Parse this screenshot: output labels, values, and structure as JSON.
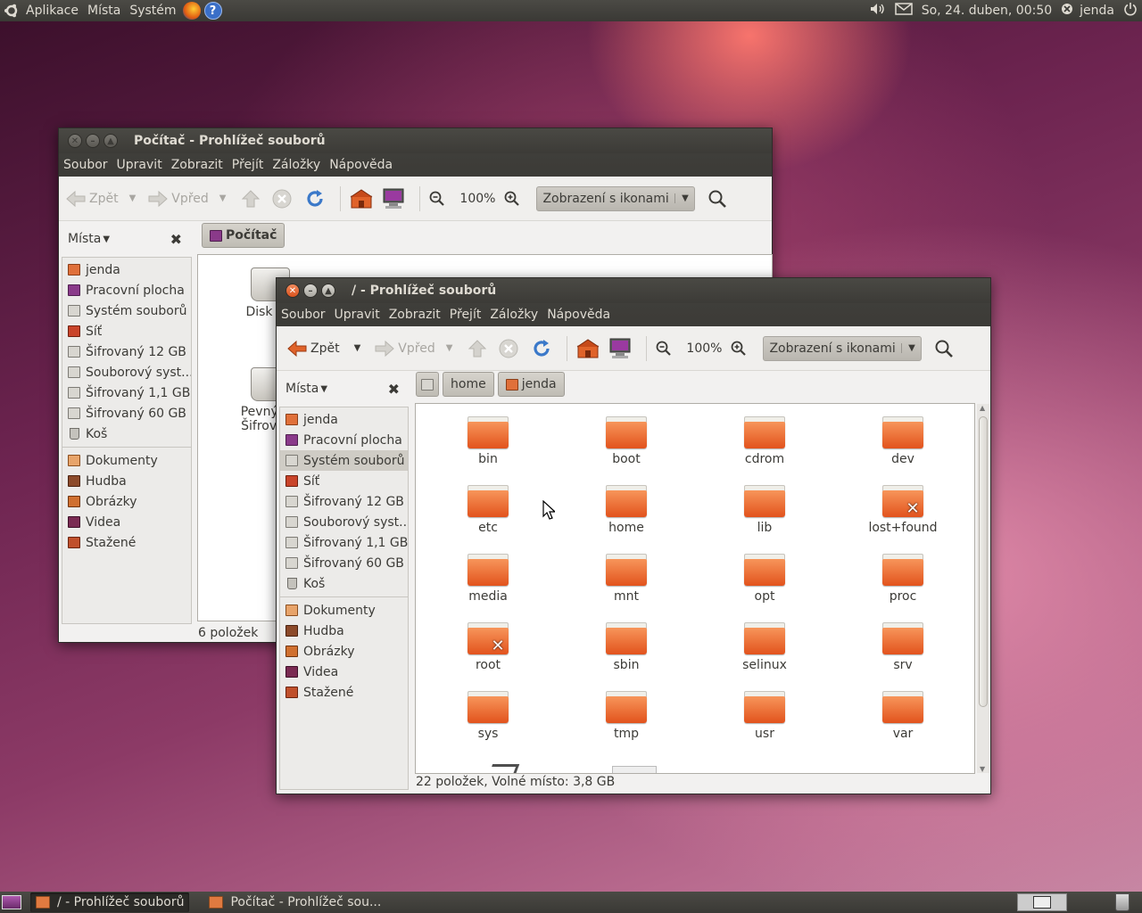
{
  "top_panel": {
    "menus": [
      "Aplikace",
      "Místa",
      "Systém"
    ],
    "datetime": "So, 24. duben, 00:50",
    "user": "jenda",
    "icons": [
      "ubuntu-logo-icon",
      "firefox-icon",
      "help-icon",
      "volume-icon",
      "mail-icon",
      "user-status-icon",
      "power-icon"
    ]
  },
  "bottom_panel": {
    "tasks": [
      "/ - Prohlížeč souborů",
      "Počítač - Prohlížeč sou..."
    ]
  },
  "back_window": {
    "title": "Počítač - Prohlížeč souborů",
    "menu": [
      "Soubor",
      "Upravit",
      "Zobrazit",
      "Přejít",
      "Záložky",
      "Nápověda"
    ],
    "toolbar": {
      "back": "Zpět",
      "forward": "Vpřed",
      "zoom": "100%",
      "view": "Zobrazení s ikonami"
    },
    "sidebar_title": "Místa",
    "breadcrumb": "Počítač",
    "sidebar_items": [
      "jenda",
      "Pracovní plocha",
      "Systém souborů",
      "Síť",
      "Šifrovaný 12 GB",
      "Souborový syst...",
      "Šifrovaný 1,1 GB",
      "Šifrovaný 60 GB",
      "Koš",
      "Dokumenty",
      "Hudba",
      "Obrázky",
      "Videa",
      "Stažené"
    ],
    "items": [
      "Disk CD",
      "Pevný dis",
      "Šifrovaný"
    ],
    "status": "6 položek"
  },
  "front_window": {
    "title": "/ - Prohlížeč souborů",
    "menu": [
      "Soubor",
      "Upravit",
      "Zobrazit",
      "Přejít",
      "Záložky",
      "Nápověda"
    ],
    "toolbar": {
      "back": "Zpět",
      "forward": "Vpřed",
      "zoom": "100%",
      "view": "Zobrazení s ikonami"
    },
    "sidebar_title": "Místa",
    "breadcrumbs": [
      "home",
      "jenda"
    ],
    "sidebar_items": [
      "jenda",
      "Pracovní plocha",
      "Systém souborů",
      "Síť",
      "Šifrovaný 12 GB",
      "Souborový syst...",
      "Šifrovaný 1,1 GB",
      "Šifrovaný 60 GB",
      "Koš",
      "Dokumenty",
      "Hudba",
      "Obrázky",
      "Videa",
      "Stažené"
    ],
    "selected_sidebar": "Systém souborů",
    "folders": [
      "bin",
      "boot",
      "cdrom",
      "dev",
      "etc",
      "home",
      "lib",
      "lost+found",
      "media",
      "mnt",
      "opt",
      "proc",
      "root",
      "sbin",
      "selinux",
      "srv",
      "sys",
      "tmp",
      "usr",
      "var"
    ],
    "locked_folders": [
      "lost+found",
      "root"
    ],
    "status": "22 položek, Volné místo: 3,8 GB"
  }
}
